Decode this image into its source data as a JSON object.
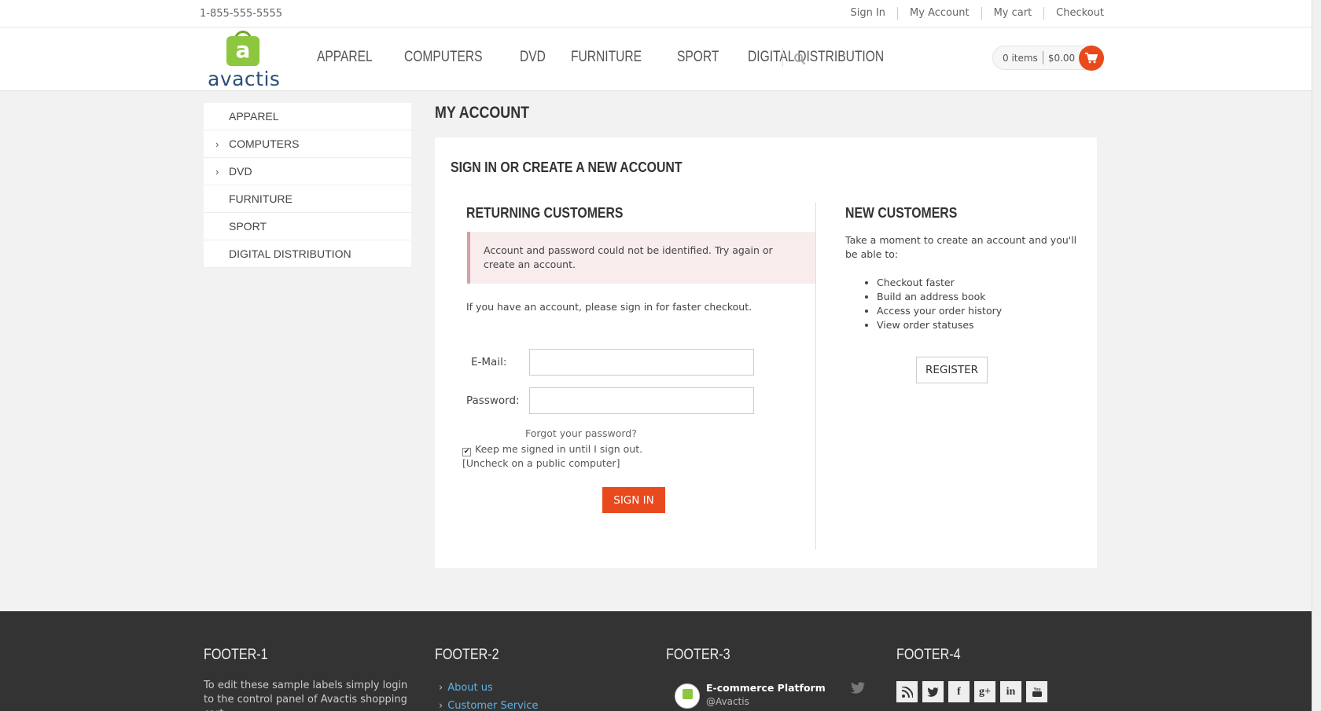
{
  "topbar": {
    "phone": "1-855-555-5555",
    "links": [
      "Sign In",
      "My Account",
      "My cart",
      "Checkout"
    ]
  },
  "header": {
    "logo_text": "avactis",
    "logo_letter": "a",
    "nav": [
      "APPAREL",
      "COMPUTERS",
      "DVD",
      "FURNITURE",
      "SPORT",
      "DIGITAL DISTRIBUTION"
    ],
    "search_icon": "search-icon",
    "cart": {
      "items": "0 items",
      "total": "$0.00",
      "icon": "cart-icon"
    }
  },
  "sidebar": {
    "items": [
      {
        "label": "APPAREL",
        "chevron": ""
      },
      {
        "label": "COMPUTERS",
        "chevron": "›"
      },
      {
        "label": "DVD",
        "chevron": "›"
      },
      {
        "label": "FURNITURE",
        "chevron": ""
      },
      {
        "label": "SPORT",
        "chevron": ""
      },
      {
        "label": "DIGITAL DISTRIBUTION",
        "chevron": ""
      }
    ]
  },
  "main": {
    "page_title": "MY ACCOUNT",
    "panel_title": "SIGN IN OR CREATE A NEW ACCOUNT",
    "returning": {
      "title": "RETURNING CUSTOMERS",
      "alert": "Account and password could not be identified. Try again or create an account.",
      "info": "If you have an account, please sign in for faster checkout.",
      "email_label": "E-Mail:",
      "email_value": "",
      "password_label": "Password:",
      "password_value": "",
      "forgot": "Forgot your password?",
      "keep_signed": "Keep me signed in until I sign out.",
      "keep_note": "[Uncheck on a public computer]",
      "keep_checked": true,
      "signin_button": "SIGN IN"
    },
    "new_customers": {
      "title": "NEW CUSTOMERS",
      "text": "Take a moment to create an account and you'll be able to:",
      "benefits": [
        "Checkout faster",
        "Build an address book",
        "Access your order history",
        "View order statuses"
      ],
      "register_button": "REGISTER"
    }
  },
  "footer": {
    "col1": {
      "title": "FOOTER-1",
      "text": "To edit these sample labels simply login to the control panel of Avactis shopping cart,"
    },
    "col2": {
      "title": "FOOTER-2",
      "links": [
        "About us",
        "Customer Service"
      ]
    },
    "col3": {
      "title": "FOOTER-3",
      "tweet_name": "E-commerce Platform",
      "tweet_handle": "@Avactis"
    },
    "col4": {
      "title": "FOOTER-4",
      "social": [
        "rss-icon",
        "twitter-icon",
        "facebook-icon",
        "google-plus-icon",
        "linkedin-icon",
        "youtube-icon"
      ]
    }
  },
  "colors": {
    "accent": "#e8491d",
    "brand_green": "#8dc63f",
    "brand_blue": "#2b4f7c",
    "footer_bg": "#333333",
    "link_blue": "#5fb2e6"
  }
}
